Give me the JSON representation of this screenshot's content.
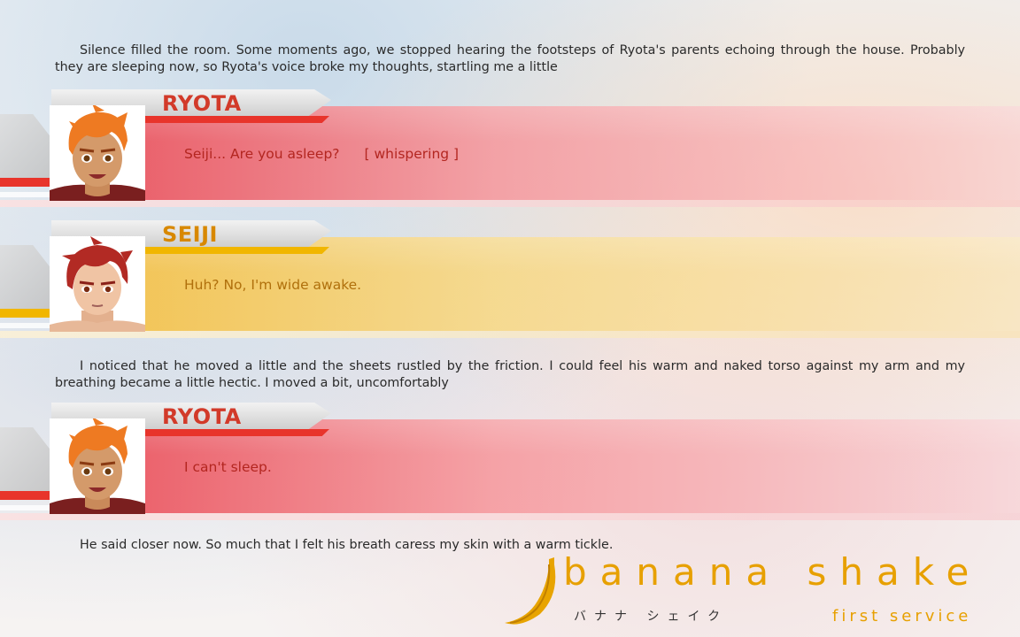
{
  "narration": [
    "Silence filled the room.  Some moments ago, we stopped hearing the footsteps of Ryota's parents echoing through the house. Probably they are sleeping now, so Ryota's voice broke my thoughts, startling me a little",
    "I noticed that he moved a little and the sheets rustled by the friction. I could feel his warm and naked torso against my arm and my breathing became a little hectic. I moved a bit, uncomfortably",
    "He said closer now. So much that I felt his breath caress my skin with a warm tickle."
  ],
  "dialogs": [
    {
      "speaker": "RYOTA",
      "line": "Seiji... Are you asleep?",
      "aside": "[ whispering ]"
    },
    {
      "speaker": "SEIJI",
      "line": "Huh? No, I'm wide awake.",
      "aside": ""
    },
    {
      "speaker": "RYOTA",
      "line": "I can't sleep.",
      "aside": ""
    }
  ],
  "colors": {
    "ryota_accent": "#e8342b",
    "seiji_accent": "#f1b600",
    "logo": "#e7a000"
  },
  "logo": {
    "title": "banana shake",
    "kana": "バナナ シェイク",
    "subtitle": "first service",
    "icon": "banana-icon"
  }
}
